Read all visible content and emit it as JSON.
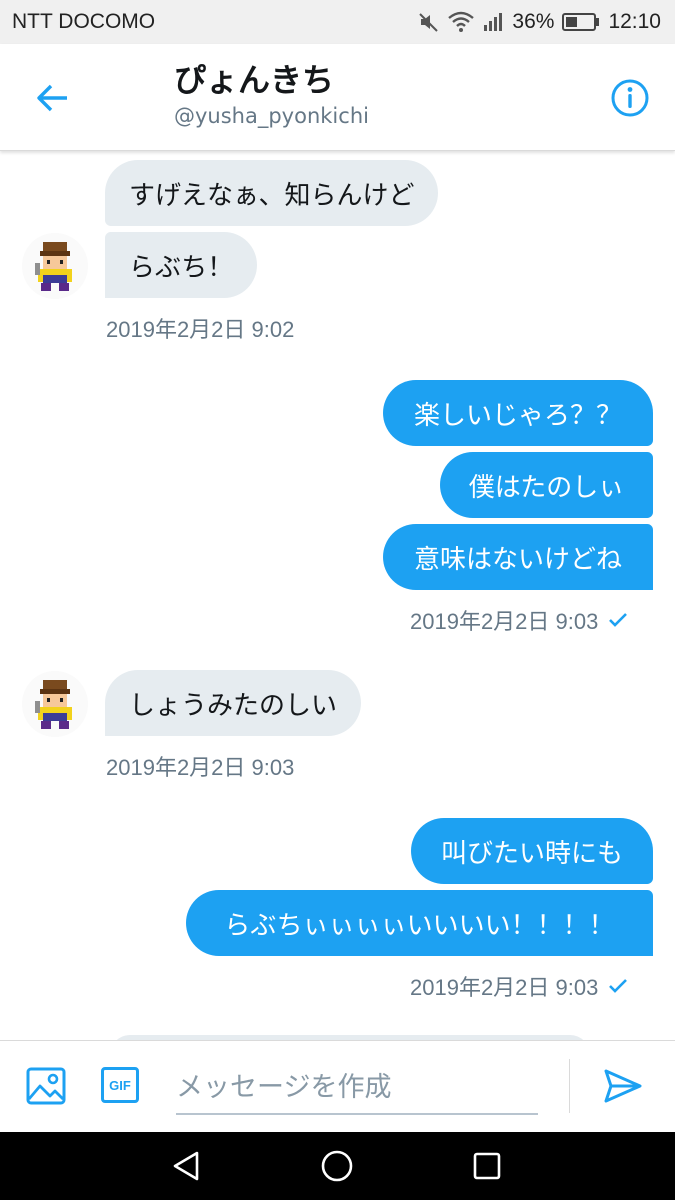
{
  "status_bar": {
    "carrier": "NTT DOCOMO",
    "battery": "36%",
    "time": "12:10"
  },
  "header": {
    "name": "ぴょんきち",
    "handle": "@yusha_pyonkichi"
  },
  "messages": [
    {
      "text": "すげえなぁ、知らんけど"
    },
    {
      "text": "らぶち！"
    },
    {
      "text": "楽しいじゃろ？？"
    },
    {
      "text": "僕はたのしぃ"
    },
    {
      "text": "意味はないけどね"
    },
    {
      "text": "しょうみたのしい"
    },
    {
      "text": "叫びたい時にも"
    },
    {
      "text": "らぶちぃぃぃぃいいいい！！！！"
    }
  ],
  "timestamps": [
    "2019年2月2日 9:02",
    "2019年2月2日 9:03",
    "2019年2月2日 9:03",
    "2019年2月2日 9:03"
  ],
  "composer": {
    "placeholder": "メッセージを作成",
    "gif_label": "GIF"
  },
  "colors": {
    "accent": "#1da1f2",
    "incoming_bubble": "#e6ecf0",
    "meta_text": "#657786"
  }
}
